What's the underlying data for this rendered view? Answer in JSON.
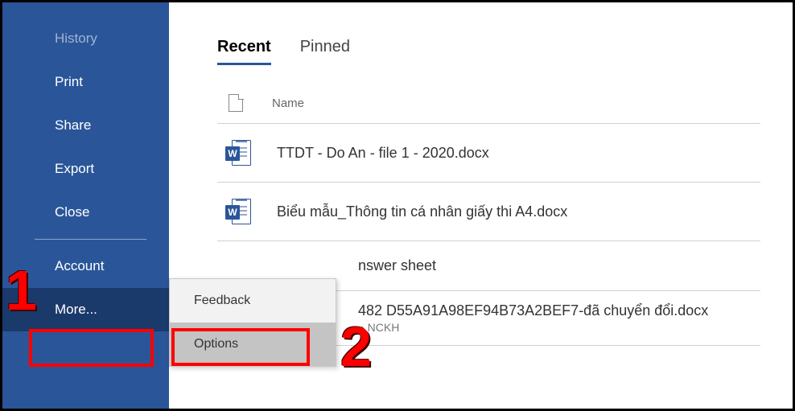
{
  "sidebar": {
    "items": [
      {
        "label": "History",
        "dim": true
      },
      {
        "label": "Print"
      },
      {
        "label": "Share"
      },
      {
        "label": "Export"
      },
      {
        "label": "Close"
      }
    ],
    "account": "Account",
    "more": "More..."
  },
  "tabs": {
    "recent": "Recent",
    "pinned": "Pinned"
  },
  "columns": {
    "name": "Name"
  },
  "files": [
    {
      "name": "TTDT - Do An - file 1 - 2020.docx"
    },
    {
      "name": "Biểu mẫu_Thông tin cá nhân giấy thi A4.docx"
    },
    {
      "name": "nswer sheet"
    },
    {
      "name": "482  D55A91A98EF94B73A2BEF7-đã chuyển đổi.docx",
      "path": "» NCKH"
    }
  ],
  "popup": {
    "feedback": "Feedback",
    "options": "Options"
  },
  "annotations": {
    "one": "1",
    "two": "2"
  }
}
